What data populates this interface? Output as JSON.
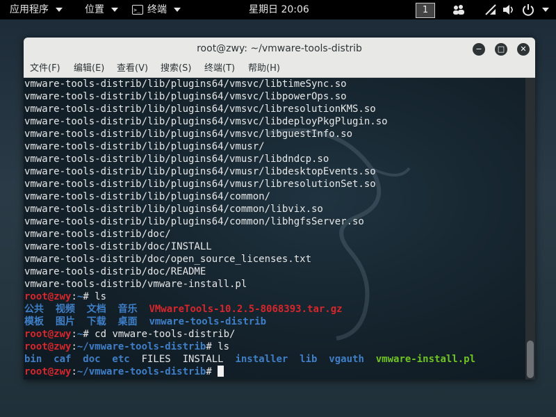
{
  "topbar": {
    "apps": "应用程序",
    "places": "位置",
    "terminal": "终端",
    "clock": "星期日 20:06",
    "workspace": "1",
    "icons": [
      "people-icon",
      "wireless-icon",
      "volume-icon",
      "power-icon"
    ]
  },
  "window": {
    "title": "root@zwy: ~/vmware-tools-distrib",
    "buttons": {
      "minimize": "−",
      "maximize": "□",
      "close": "✕"
    },
    "menu": [
      "文件(F)",
      "编辑(E)",
      "查看(V)",
      "搜索(S)",
      "终端(T)",
      "帮助(H)"
    ]
  },
  "terminal": {
    "lines": [
      [
        {
          "t": "vmware-tools-distrib/lib/plugins64/vmsvc/libtimeSync.so",
          "c": "w"
        }
      ],
      [
        {
          "t": "vmware-tools-distrib/lib/plugins64/vmsvc/libpowerOps.so",
          "c": "w"
        }
      ],
      [
        {
          "t": "vmware-tools-distrib/lib/plugins64/vmsvc/libresolutionKMS.so",
          "c": "w"
        }
      ],
      [
        {
          "t": "vmware-tools-distrib/lib/plugins64/vmsvc/libdeployPkgPlugin.so",
          "c": "w"
        }
      ],
      [
        {
          "t": "vmware-tools-distrib/lib/plugins64/vmsvc/libguestInfo.so",
          "c": "w"
        }
      ],
      [
        {
          "t": "vmware-tools-distrib/lib/plugins64/vmusr/",
          "c": "w"
        }
      ],
      [
        {
          "t": "vmware-tools-distrib/lib/plugins64/vmusr/libdndcp.so",
          "c": "w"
        }
      ],
      [
        {
          "t": "vmware-tools-distrib/lib/plugins64/vmusr/libdesktopEvents.so",
          "c": "w"
        }
      ],
      [
        {
          "t": "vmware-tools-distrib/lib/plugins64/vmusr/libresolutionSet.so",
          "c": "w"
        }
      ],
      [
        {
          "t": "vmware-tools-distrib/lib/plugins64/common/",
          "c": "w"
        }
      ],
      [
        {
          "t": "vmware-tools-distrib/lib/plugins64/common/libvix.so",
          "c": "w"
        }
      ],
      [
        {
          "t": "vmware-tools-distrib/lib/plugins64/common/libhgfsServer.so",
          "c": "w"
        }
      ],
      [
        {
          "t": "vmware-tools-distrib/doc/",
          "c": "w"
        }
      ],
      [
        {
          "t": "vmware-tools-distrib/doc/INSTALL",
          "c": "w"
        }
      ],
      [
        {
          "t": "vmware-tools-distrib/doc/open_source_licenses.txt",
          "c": "w"
        }
      ],
      [
        {
          "t": "vmware-tools-distrib/doc/README",
          "c": "w"
        }
      ],
      [
        {
          "t": "vmware-tools-distrib/vmware-install.pl",
          "c": "w"
        }
      ],
      [
        {
          "t": "root@zwy",
          "c": "r"
        },
        {
          "t": ":",
          "c": "w"
        },
        {
          "t": "~",
          "c": "b"
        },
        {
          "t": "# ls",
          "c": "w"
        }
      ],
      [
        {
          "t": "公共  视频  文档  音乐  ",
          "c": "b"
        },
        {
          "t": "VMwareTools-10.2.5-8068393.tar.gz",
          "c": "r"
        }
      ],
      [
        {
          "t": "模板  图片  下载  桌面  ",
          "c": "b"
        },
        {
          "t": "vmware-tools-distrib",
          "c": "b"
        }
      ],
      [
        {
          "t": "root@zwy",
          "c": "r"
        },
        {
          "t": ":",
          "c": "w"
        },
        {
          "t": "~",
          "c": "b"
        },
        {
          "t": "# cd vmware-tools-distrib/",
          "c": "w"
        }
      ],
      [
        {
          "t": "root@zwy",
          "c": "r"
        },
        {
          "t": ":",
          "c": "w"
        },
        {
          "t": "~/vmware-tools-distrib",
          "c": "b"
        },
        {
          "t": "# ls",
          "c": "w"
        }
      ],
      [
        {
          "t": "bin  caf  doc  etc",
          "c": "b"
        },
        {
          "t": "  FILES  INSTALL  ",
          "c": "w"
        },
        {
          "t": "installer  lib  vgauth",
          "c": "b"
        },
        {
          "t": "  ",
          "c": "w"
        },
        {
          "t": "vmware-install.pl",
          "c": "g"
        }
      ],
      [
        {
          "t": "root@zwy",
          "c": "r"
        },
        {
          "t": ":",
          "c": "w"
        },
        {
          "t": "~/vmware-tools-distrib",
          "c": "b"
        },
        {
          "t": "# ",
          "c": "w"
        }
      ]
    ]
  }
}
